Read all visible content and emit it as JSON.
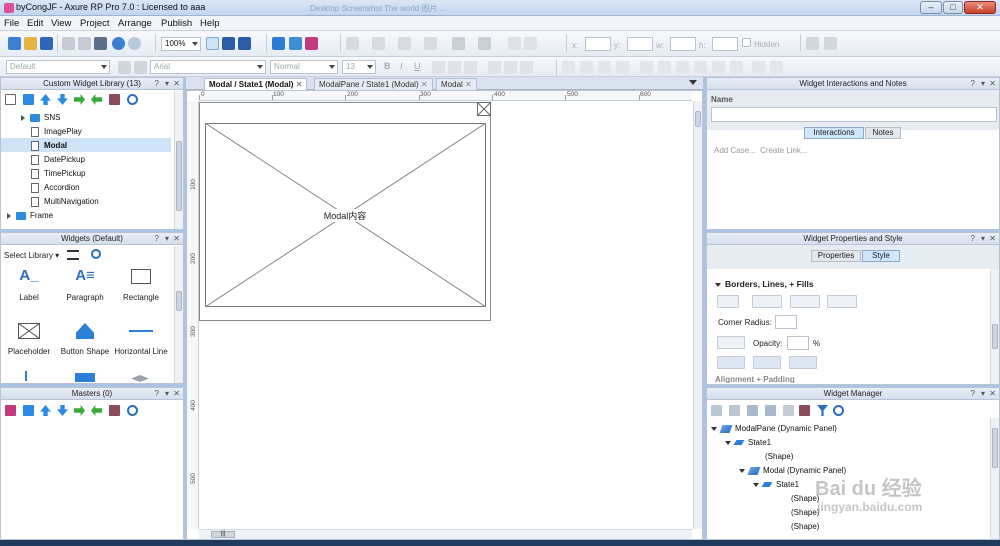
{
  "window": {
    "title": "byCongJF - Axure RP Pro 7.0 : Licensed to aaa",
    "ghost_tabs": "Desktop   Screenshot   The world   图片   ...",
    "min": "–",
    "max": "□",
    "close": "✕"
  },
  "menu": [
    "File",
    "Edit",
    "View",
    "Project",
    "Arrange",
    "Publish",
    "Help"
  ],
  "toolbar1": {
    "zoom": "100%",
    "hidden_label": "Hidden",
    "x_label": "x:",
    "y_label": "y:",
    "w_label": "w:",
    "h_label": "h:"
  },
  "toolbar2": {
    "style": "Default",
    "font": "Arial",
    "weight": "Normal",
    "size": "13"
  },
  "custom_library": {
    "header": "Custom Widget Library (13)",
    "items": [
      {
        "label": "SNS",
        "kind": "folder"
      },
      {
        "label": "ImagePlay",
        "kind": "doc"
      },
      {
        "label": "Modal",
        "kind": "doc"
      },
      {
        "label": "DatePickup",
        "kind": "doc"
      },
      {
        "label": "TimePickup",
        "kind": "doc"
      },
      {
        "label": "Accordion",
        "kind": "doc"
      },
      {
        "label": "MultiNavigation",
        "kind": "doc"
      },
      {
        "label": "Frame",
        "kind": "folder"
      }
    ],
    "selected": "Modal"
  },
  "widgets": {
    "header": "Widgets (Default)",
    "select_library": "Select Library",
    "items": [
      "Label",
      "Paragraph",
      "Rectangle",
      "Placeholder",
      "Button Shape",
      "Horizontal Line"
    ]
  },
  "masters": {
    "header": "Masters (0)"
  },
  "panel_ctl": {
    "help": "?",
    "menu": "▾",
    "close": "✕"
  },
  "tabs": [
    {
      "label": "Modal / State1 (Modal)",
      "active": true
    },
    {
      "label": "ModalPane / State1 (Modal)",
      "active": false
    },
    {
      "label": "Modal",
      "active": false
    }
  ],
  "canvas": {
    "ruler_h": [
      "0",
      "100",
      "200",
      "300",
      "400",
      "500",
      "600"
    ],
    "ruler_v": [
      "100",
      "200",
      "300",
      "400",
      "500"
    ],
    "placeholder_text": "Modal内容",
    "scroll_indicator": "|||"
  },
  "interactions": {
    "header": "Widget Interactions and Notes",
    "name_label": "Name",
    "tabs": [
      "Interactions",
      "Notes"
    ],
    "active_tab": "Interactions",
    "add_case": "Add Case...",
    "create_link": "Create Link..."
  },
  "properties": {
    "header": "Widget Properties and Style",
    "tabs": [
      "Properties",
      "Style"
    ],
    "active_tab": "Style",
    "section": "Borders, Lines, + Fills",
    "corner_radius_label": "Corner Radius:",
    "opacity_label": "Opacity:",
    "opacity_unit": "%",
    "next_section": "Alignment + Padding"
  },
  "manager": {
    "header": "Widget Manager",
    "tree": [
      {
        "label": "ModalPane (Dynamic Panel)",
        "indent": 0,
        "icon": "dynamic-panel"
      },
      {
        "label": "State1",
        "indent": 1,
        "icon": "state"
      },
      {
        "label": "(Shape)",
        "indent": 2,
        "icon": "none"
      },
      {
        "label": "Modal (Dynamic Panel)",
        "indent": 2,
        "icon": "dynamic-panel"
      },
      {
        "label": "State1",
        "indent": 3,
        "icon": "state"
      },
      {
        "label": "(Shape)",
        "indent": 4,
        "icon": "none"
      },
      {
        "label": "(Shape)",
        "indent": 4,
        "icon": "none"
      },
      {
        "label": "(Shape)",
        "indent": 4,
        "icon": "none"
      }
    ]
  },
  "watermark": {
    "text": "Bai du 经验",
    "sub": "jingyan.baidu.com"
  },
  "colors": {
    "accent": "#2a8be0",
    "selected_row": "#cfe3f6",
    "active_tab": "#cfe6fb"
  }
}
